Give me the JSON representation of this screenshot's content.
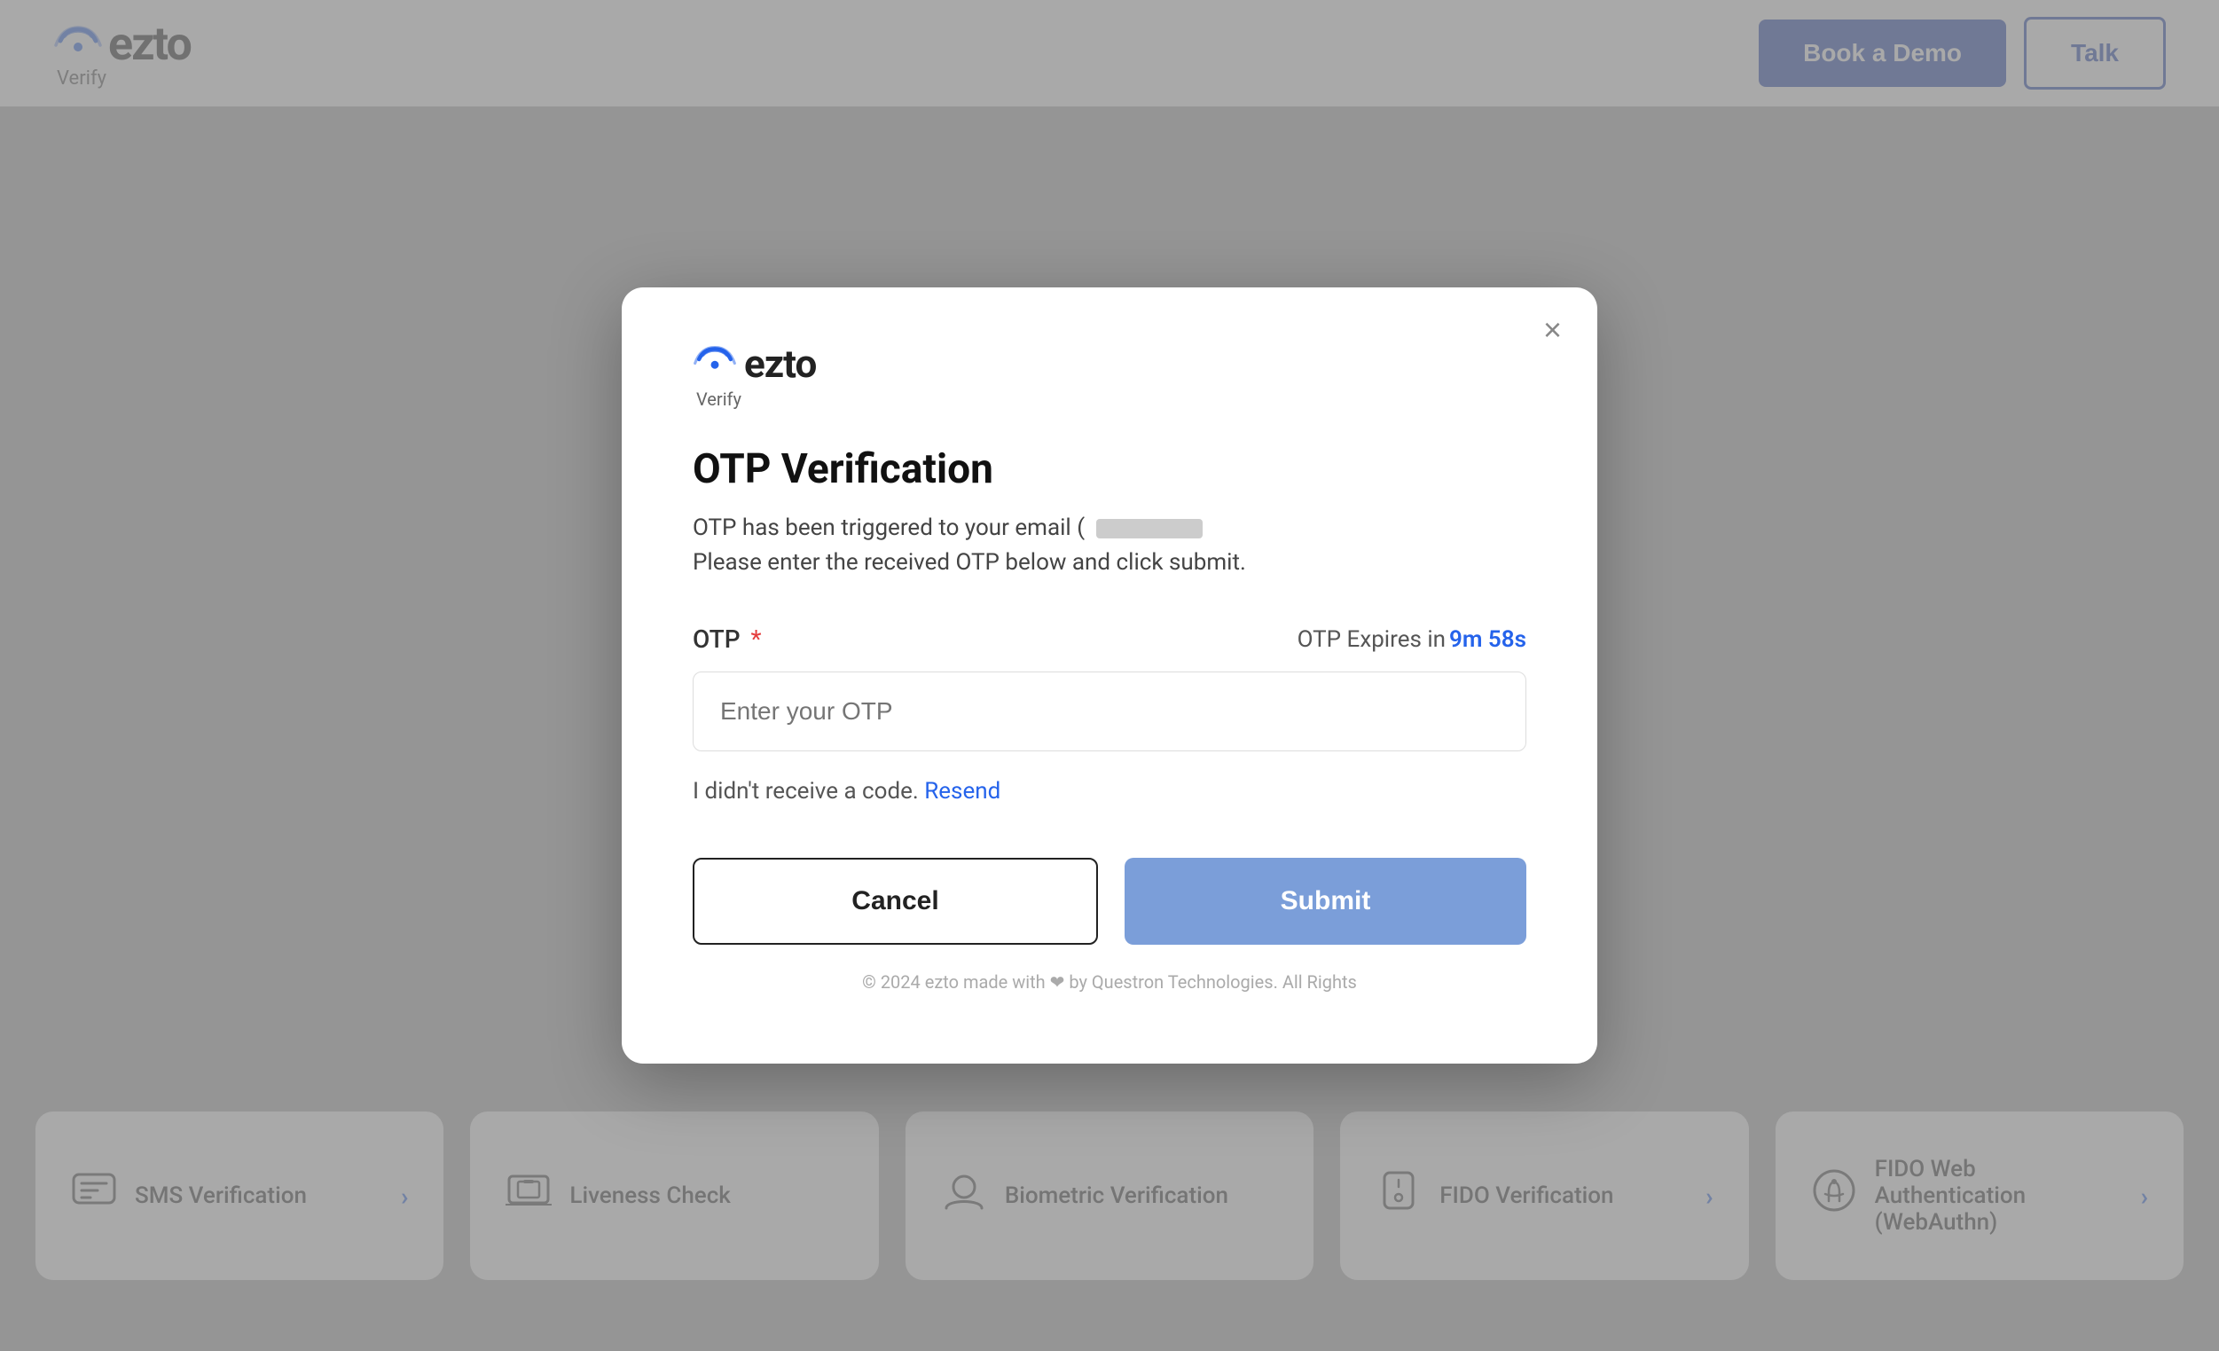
{
  "header": {
    "logo_text": "ezto",
    "logo_subtitle": "Verify",
    "btn_book_demo": "Book a Demo",
    "btn_talk": "Talk"
  },
  "bottom_cards": [
    {
      "label": "SMS Verification",
      "icon": "💬",
      "has_arrow": true
    },
    {
      "label": "Liveness Check",
      "icon": "🖥️",
      "has_arrow": false
    },
    {
      "label": "Biometric Verification",
      "icon": "",
      "has_arrow": false
    },
    {
      "label": "FIDO Verification",
      "icon": "",
      "has_arrow": true
    },
    {
      "label": "FIDO Web Authentication (WebAuthn)",
      "icon": "👆",
      "has_arrow": true
    }
  ],
  "modal": {
    "logo_text": "ezto",
    "logo_subtitle": "Verify",
    "title": "OTP Verification",
    "desc_line1": "OTP has been triggered to your email (",
    "desc_line2": "Please enter the received OTP below and click submit.",
    "otp_label": "OTP",
    "otp_required_marker": "*",
    "otp_expires_label": "OTP Expires in",
    "otp_timer": "9m 58s",
    "otp_placeholder": "Enter your OTP",
    "resend_text": "I didn't receive a code.",
    "resend_link": "Resend",
    "btn_cancel": "Cancel",
    "btn_submit": "Submit",
    "footer": "© 2024 ezto made with ❤ by Questron Technologies. All Rights"
  }
}
